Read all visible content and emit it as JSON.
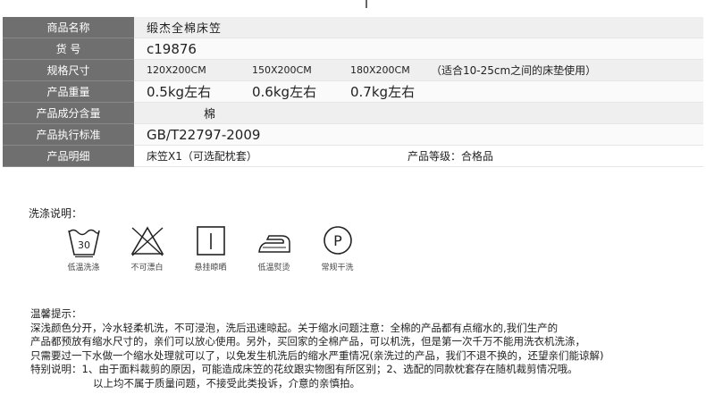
{
  "spec": {
    "name_label": "商品名称",
    "name_value": "缎杰全棉床笠",
    "sku_label": "货 号",
    "sku_value": "c19876",
    "size_label": "规格尺寸",
    "sizes": [
      "120X200CM",
      "150X200CM",
      "180X200CM"
    ],
    "size_note": "（适合10-25cm之间的床垫使用）",
    "weight_label": "产品重量",
    "weights": [
      "0.5kg左右",
      "0.6kg左右",
      "0.7kg左右"
    ],
    "composition_label": "产品成分含量",
    "composition_value": "棉",
    "standard_label": "产品执行标准",
    "standard_value": "GB/T22797-2009",
    "detail_label": "产品明细",
    "detail_value": "床笠X1（可选配枕套）",
    "grade_value": "产品等级：合格品"
  },
  "washing": {
    "title": "洗涤说明：",
    "icons": [
      {
        "icon": "wash-30-icon",
        "temp": "30",
        "caption": "低温洗涤"
      },
      {
        "icon": "no-bleach-icon",
        "caption": "不可漂白"
      },
      {
        "icon": "hang-dry-icon",
        "caption": "悬挂晾晒"
      },
      {
        "icon": "iron-low-icon",
        "caption": "低温熨烫"
      },
      {
        "icon": "dry-clean-p-icon",
        "letter": "P",
        "caption": "常规干洗"
      }
    ]
  },
  "tips": {
    "title": "温馨提示：",
    "lines": [
      "深浅颜色分开，冷水轻柔机洗，不可浸泡，洗后迅速晾起。关于缩水问题注意：全棉的产品都有点缩水的,我们生产的",
      "产品都预放有缩水尺寸的，亲们可以放心使用。另外，买回家的全棉产品，可以机洗，但是第一次千万不能用洗衣机洗涤，",
      "只需要过一下水做一个缩水处理就可以了，以免发生机洗后的缩水严重情况(亲洗过的产品，我们不退不换的，还望亲们能谅解)",
      "特别说明：1、由于面料裁剪的原因，可能造成床笠的花纹跟实物图有所区别；2、选配的同款枕套存在随机裁剪情况哦。"
    ],
    "last_line": "以上均不属于质量问题，不接受此类投诉，介意的亲慎拍。"
  },
  "colors": {
    "label_bg": "#6f6f6f",
    "row_bg": "#efefef"
  }
}
